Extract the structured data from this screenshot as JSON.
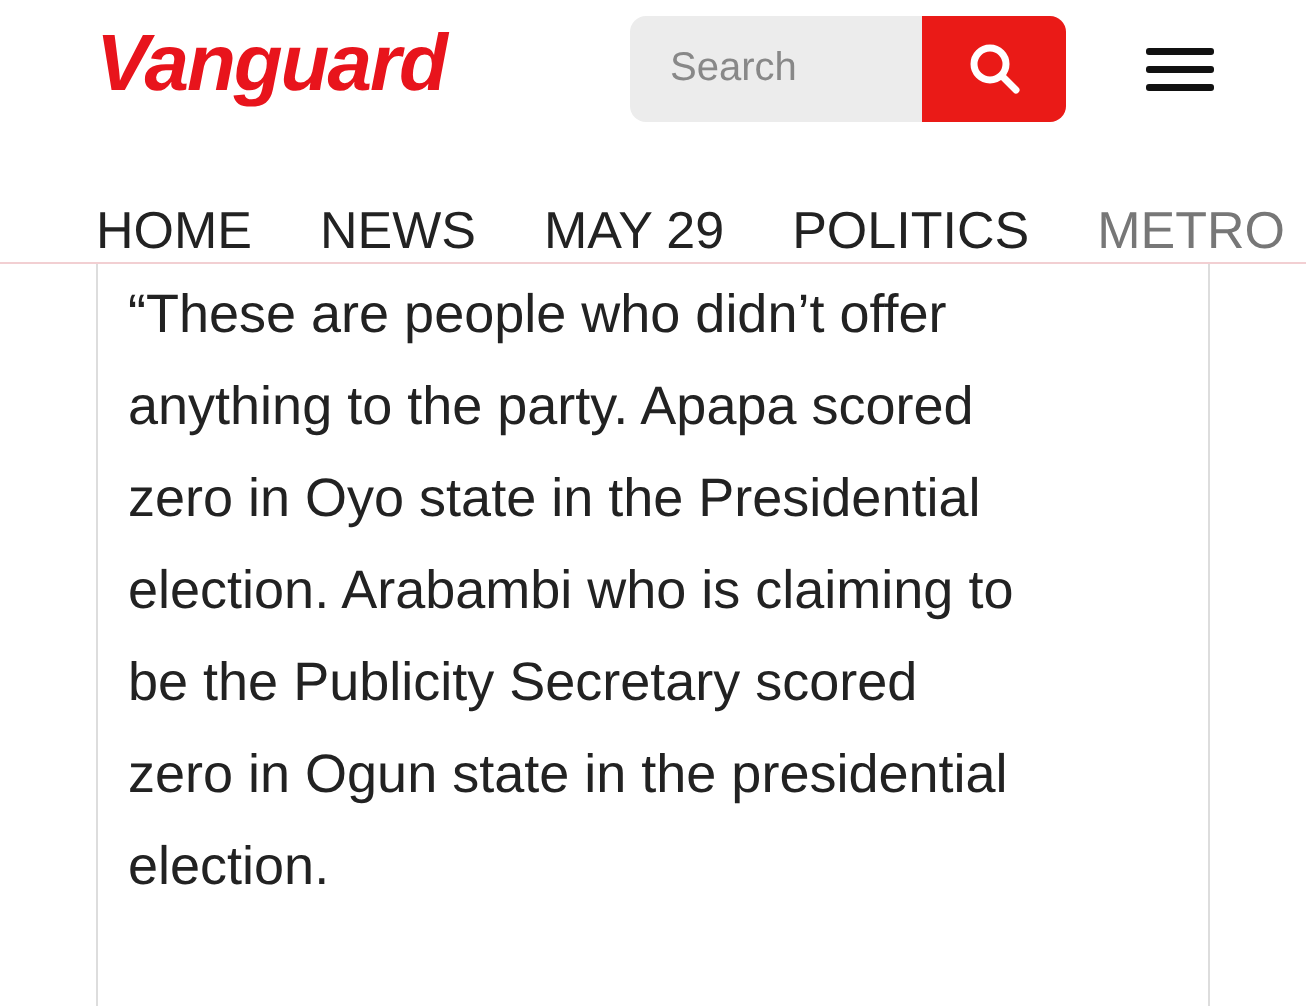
{
  "header": {
    "logo": "Vanguard",
    "search": {
      "placeholder": "Search"
    }
  },
  "nav": [
    {
      "label": "HOME",
      "faded": false
    },
    {
      "label": "NEWS",
      "faded": false
    },
    {
      "label": "MAY 29",
      "faded": false
    },
    {
      "label": "POLITICS",
      "faded": false
    },
    {
      "label": "METRO",
      "faded": true
    }
  ],
  "quote": {
    "lines": [
      "“These are people who didn’t offer",
      "anything to the party. Apapa scored",
      "zero in Oyo state in the Presidential",
      "election. Arabambi who is claiming to",
      "be the Publicity Secretary scored",
      "zero in Ogun state in the presidential",
      "election."
    ]
  }
}
